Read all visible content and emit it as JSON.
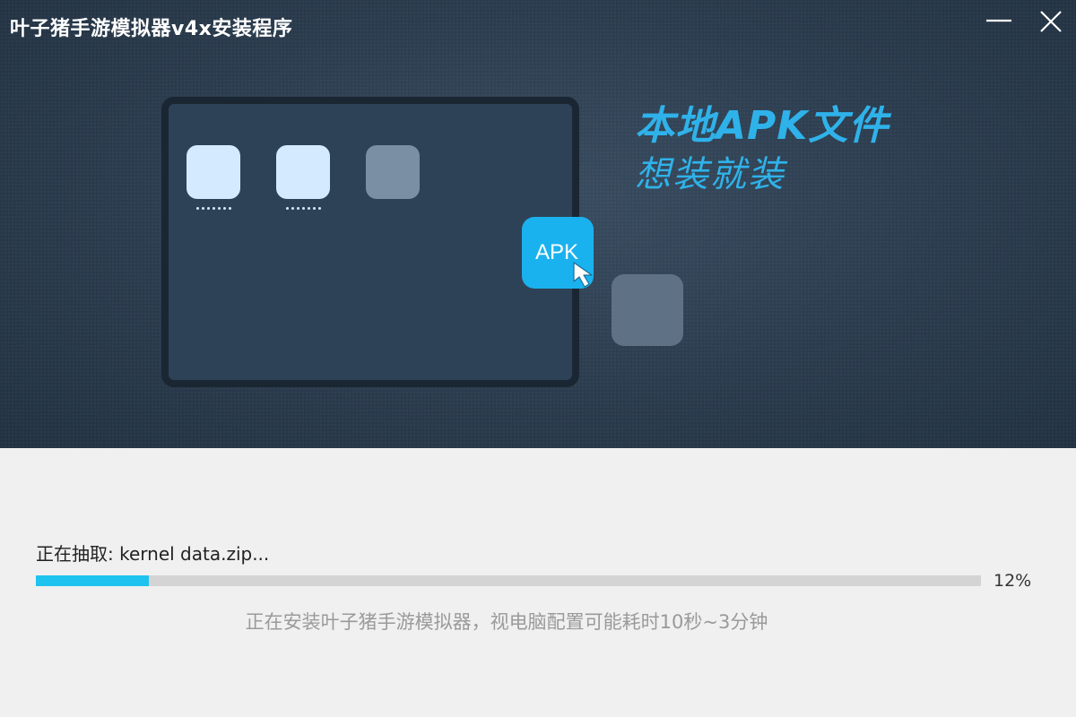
{
  "window": {
    "title": "叶子猪手游模拟器v4x安装程序",
    "minimize_icon": "minimize-icon",
    "close_icon": "close-icon"
  },
  "banner": {
    "apk_label": "APK",
    "headline": "本地APK文件",
    "subline": "想装就装",
    "accent_color": "#2fb2ea",
    "apk_tile_color": "#1ab2ee"
  },
  "status": {
    "label": "正在抽取: kernel data.zip...",
    "progress_percent": 12,
    "progress_text": "12%",
    "progress_color": "#1ec3ef",
    "note": "正在安装叶子猪手游模拟器，视电脑配置可能耗时10秒~3分钟"
  }
}
